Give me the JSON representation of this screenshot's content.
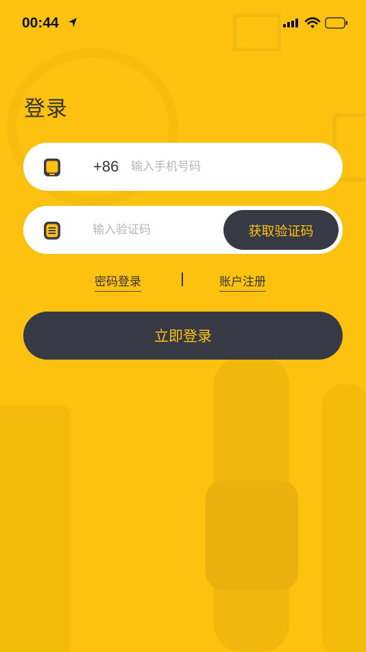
{
  "status_bar": {
    "time": "00:44"
  },
  "page": {
    "title": "登录"
  },
  "phone_field": {
    "country_code": "+86",
    "placeholder": "输入手机号码",
    "value": "",
    "icon": "phone-icon"
  },
  "code_field": {
    "placeholder": "输入验证码",
    "value": "",
    "icon": "message-icon",
    "get_code_label": "获取验证码"
  },
  "links": {
    "password_login": "密码登录",
    "register": "账户注册"
  },
  "login_button": {
    "label": "立即登录"
  },
  "colors": {
    "background": "#FDC20F",
    "button_dark": "#373944",
    "accent_text": "#FDC20F"
  }
}
